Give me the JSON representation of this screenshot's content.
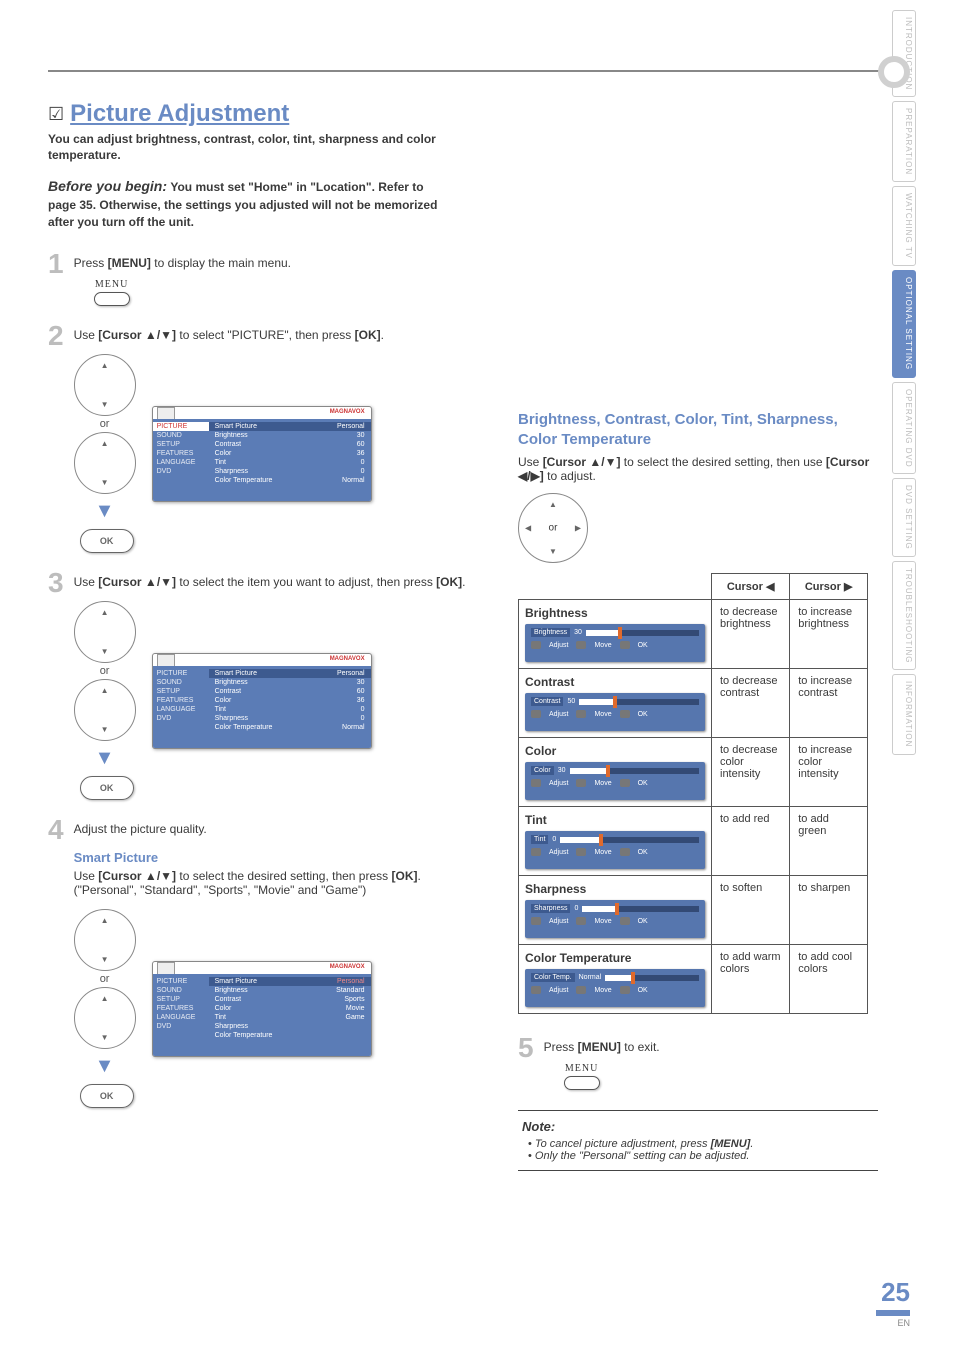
{
  "sidebar_tabs": [
    "INTRODUCTION",
    "PREPARATION",
    "WATCHING TV",
    "OPTIONAL SETTING",
    "OPERATING DVD",
    "DVD SETTING",
    "TROUBLESHOOTING",
    "INFORMATION"
  ],
  "active_tab_index": 3,
  "title": "Picture Adjustment",
  "intro": "You can adjust brightness, contrast, color, tint, sharpness and color temperature.",
  "before_begin_label": "Before you begin:",
  "before_begin_text": "You must set \"Home\" in \"Location\". Refer to page 35. Otherwise, the settings you adjusted will not be memorized after you turn off the unit.",
  "menu_label": "MENU",
  "ok_label": "OK",
  "or_label": "or",
  "steps": {
    "s1": {
      "num": "1",
      "text_before": "Press ",
      "bold": "[MENU]",
      "text_after": " to display the main menu."
    },
    "s2": {
      "num": "2",
      "text_before": "Use ",
      "bold": "[Cursor ▲/▼]",
      "text_after": " to select \"PICTURE\", then press ",
      "bold2": "[OK]",
      "end": "."
    },
    "s3": {
      "num": "3",
      "text_before": "Use ",
      "bold": "[Cursor ▲/▼]",
      "text_after": " to select the item you want to adjust, then press ",
      "bold2": "[OK]",
      "end": "."
    },
    "s4": {
      "num": "4",
      "text": "Adjust the picture quality."
    },
    "s5": {
      "num": "5",
      "text_before": "Press ",
      "bold": "[MENU]",
      "text_after": " to exit."
    }
  },
  "smart_picture": {
    "heading": "Smart Picture",
    "line1_a": "Use ",
    "line1_b": "[Cursor ▲/▼]",
    "line1_c": " to select the desired setting, then press ",
    "line1_d": "[OK]",
    "line1_e": ".",
    "line2": "(\"Personal\", \"Standard\", \"Sports\", \"Movie\" and \"Game\")"
  },
  "right_section": {
    "heading": "Brightness, Contrast, Color, Tint, Sharpness, Color Temperature",
    "line1_a": "Use ",
    "line1_b": "[Cursor ▲/▼]",
    "line1_c": " to select the desired setting, then use ",
    "line1_d": "[Cursor ◀/▶]",
    "line1_e": " to adjust."
  },
  "table": {
    "head_left": "Cursor ◀",
    "head_right": "Cursor ▶",
    "rows": [
      {
        "name": "Brightness",
        "left": "to decrease brightness",
        "right": "to increase brightness",
        "label": "Brightness",
        "val": "30"
      },
      {
        "name": "Contrast",
        "left": "to decrease contrast",
        "right": "to increase contrast",
        "label": "Contrast",
        "val": "50"
      },
      {
        "name": "Color",
        "left": "to decrease color intensity",
        "right": "to increase color intensity",
        "label": "Color",
        "val": "30"
      },
      {
        "name": "Tint",
        "left": "to add red",
        "right": "to add green",
        "label": "Tint",
        "val": "0"
      },
      {
        "name": "Sharpness",
        "left": "to soften",
        "right": "to sharpen",
        "label": "Sharpness",
        "val": "0"
      },
      {
        "name": "Color Temperature",
        "left": "to add warm colors",
        "right": "to add cool colors",
        "label": "Color Temp.",
        "val": "Normal"
      }
    ],
    "adjust": "Adjust",
    "move": "Move",
    "ok": "OK"
  },
  "note": {
    "title": "Note:",
    "items": [
      "To cancel picture adjustment, press [MENU].",
      "Only the \"Personal\" setting can be adjusted."
    ],
    "bold_in_0": "[MENU]"
  },
  "menu_screenshot": {
    "brand": "MAGNAVOX",
    "left_items": [
      "PICTURE",
      "SOUND",
      "SETUP",
      "FEATURES",
      "LANGUAGE",
      "DVD"
    ],
    "right_rows": [
      {
        "l": "Smart Picture",
        "r": "Personal"
      },
      {
        "l": "Brightness",
        "r": "30"
      },
      {
        "l": "Contrast",
        "r": "60"
      },
      {
        "l": "Color",
        "r": "36"
      },
      {
        "l": "Tint",
        "r": "0"
      },
      {
        "l": "Sharpness",
        "r": "0"
      },
      {
        "l": "Color Temperature",
        "r": "Normal"
      }
    ],
    "sp_options": [
      "Personal",
      "Standard",
      "Sports",
      "Movie",
      "Game"
    ]
  },
  "footer": {
    "page": "25",
    "en": "EN"
  }
}
